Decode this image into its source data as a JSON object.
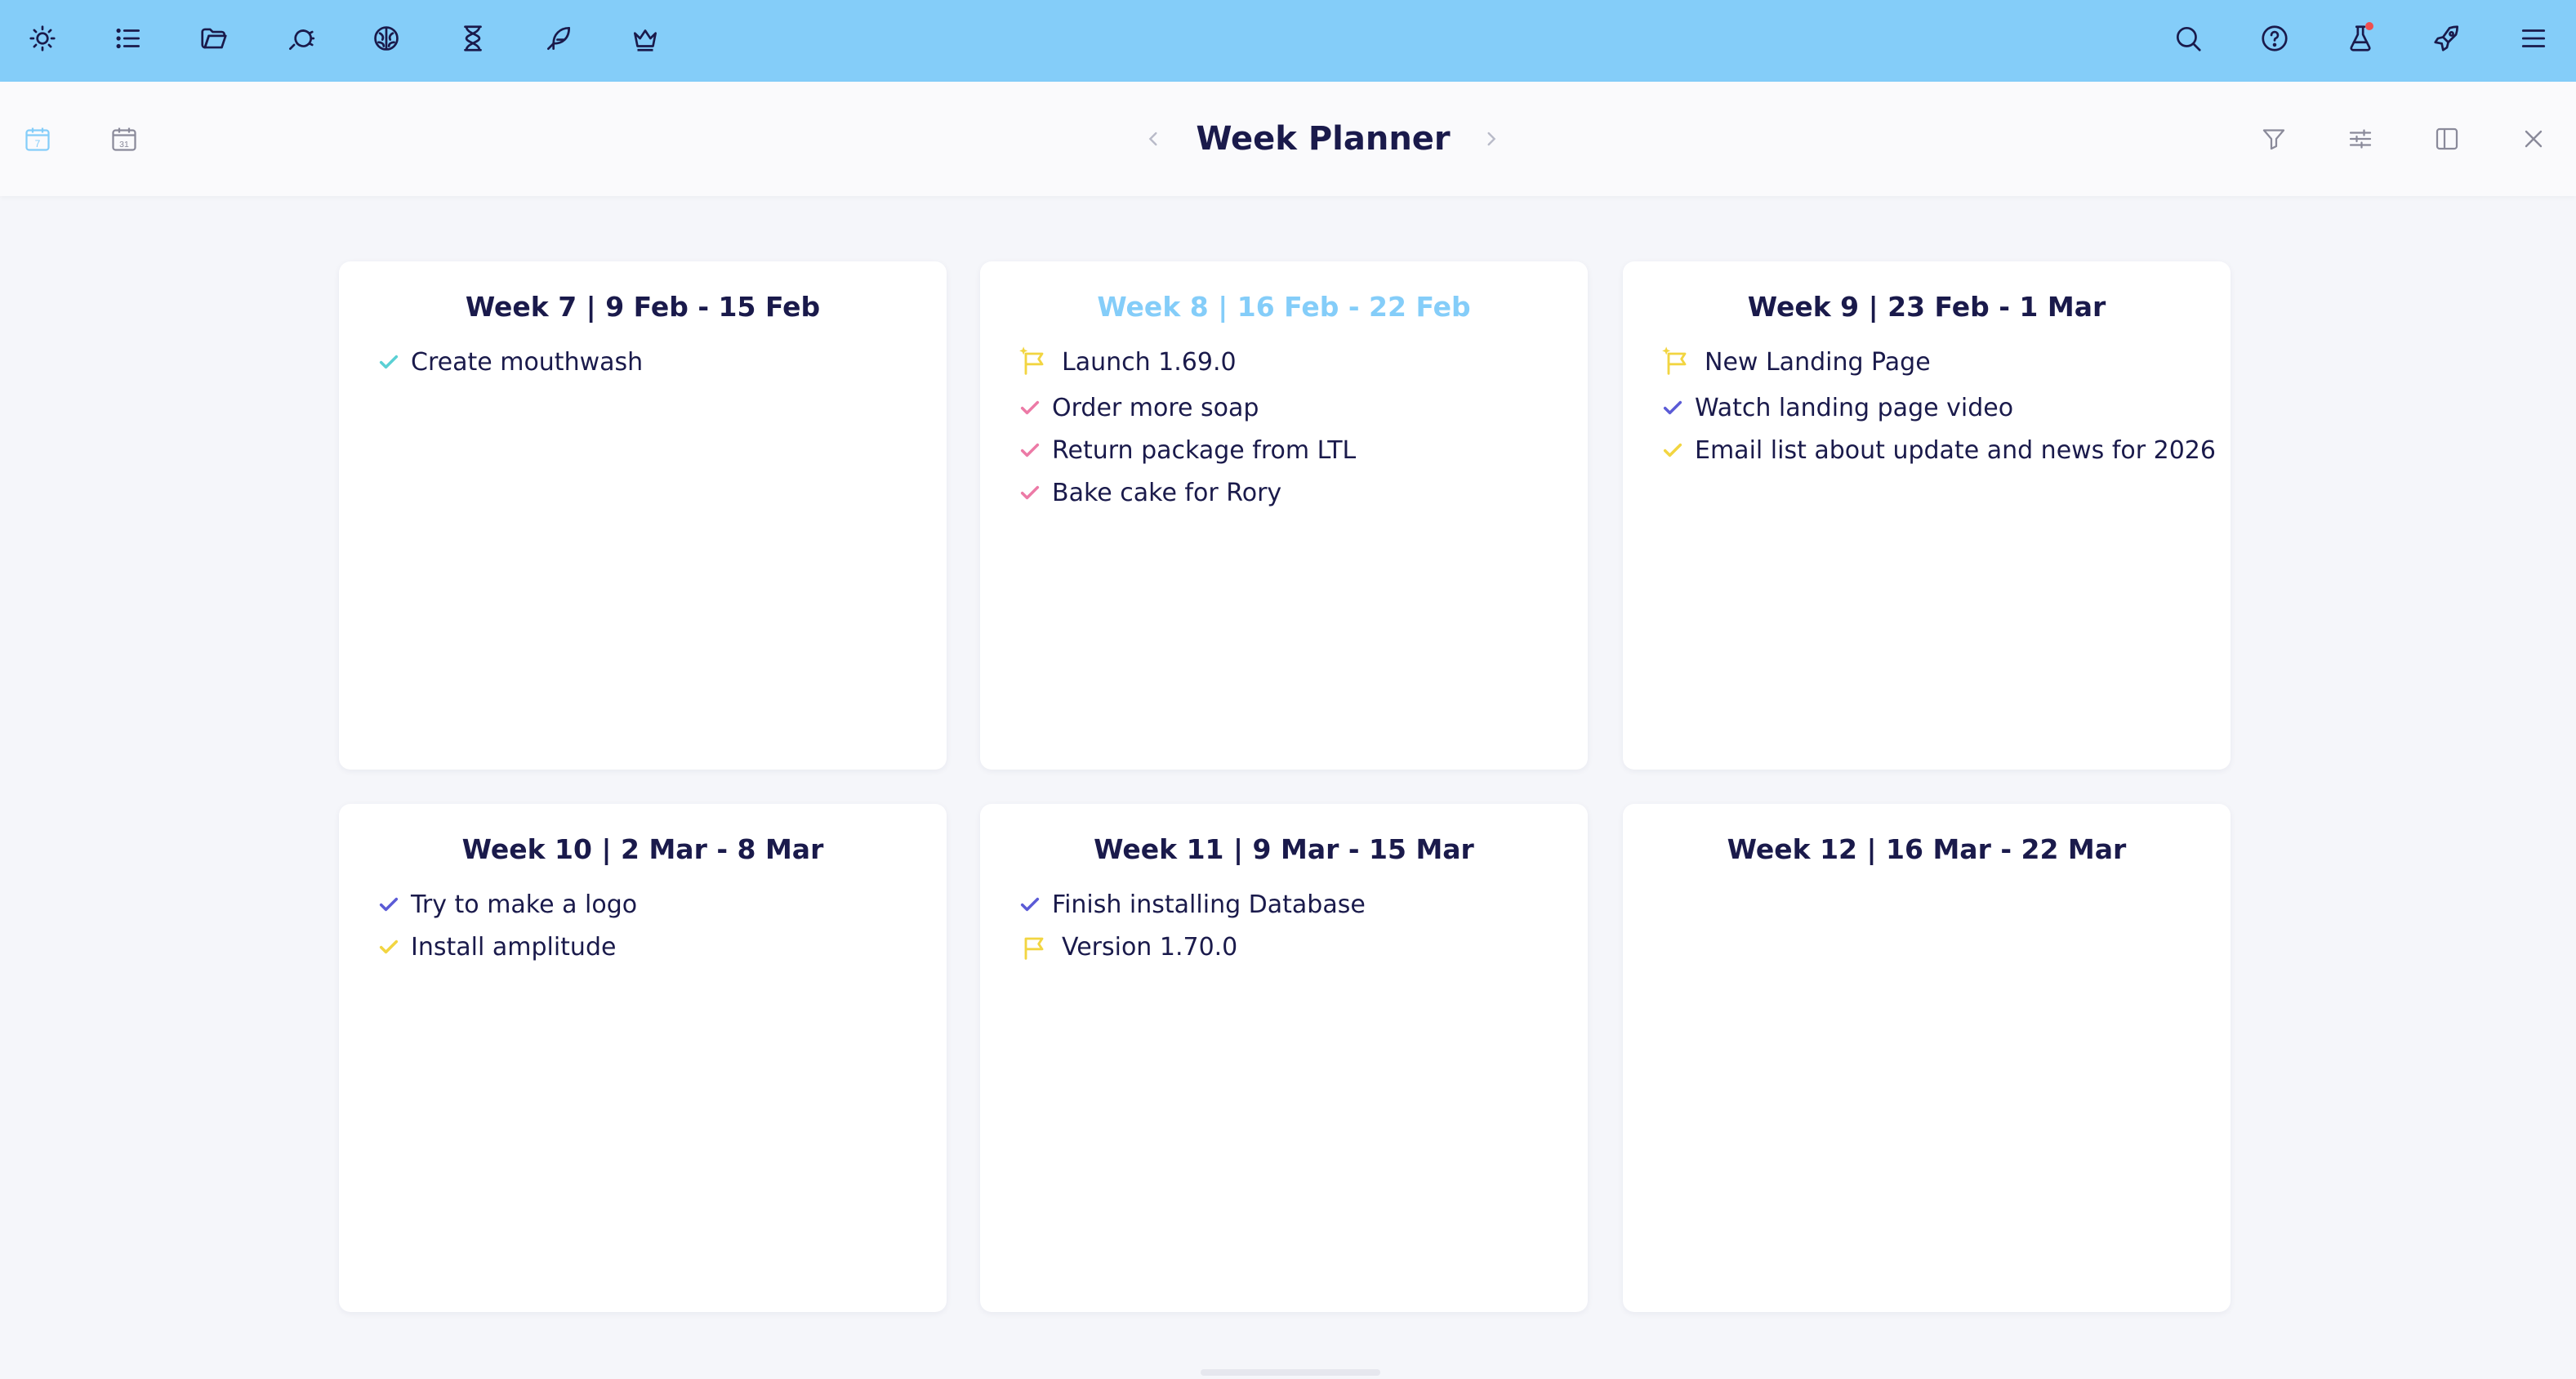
{
  "colors": {
    "topbar": "#84cdf9",
    "accent": "#84cdf9",
    "text": "#1a1a4b",
    "check_teal": "#5ad0d4",
    "check_pink": "#ec7aa6",
    "check_purple": "#5b5bd6",
    "check_yellow": "#f2d541",
    "flag_yellow": "#f2d541",
    "notification": "#ef4f4f"
  },
  "topbar": {
    "left_icons": [
      "sun-icon",
      "list-icon",
      "folder-icon",
      "daydream-icon",
      "brain-icon",
      "hourglass-icon",
      "feather-icon",
      "crown-icon"
    ],
    "right_icons": [
      "search-icon",
      "help-icon",
      "flask-icon",
      "rocket-icon",
      "menu-icon"
    ]
  },
  "header": {
    "title": "Week Planner",
    "week_view_day": "7",
    "month_view_day": "31"
  },
  "weeks": [
    {
      "title": "Week 7 | 9 Feb - 15 Feb",
      "current": false,
      "tasks": [
        {
          "type": "task",
          "label": "Create mouthwash",
          "color": "#5ad0d4"
        }
      ]
    },
    {
      "title": "Week 8 | 16 Feb - 22 Feb",
      "current": true,
      "tasks": [
        {
          "type": "milestone",
          "label": "Launch 1.69.0",
          "color": "#f2d541",
          "sparkle": true
        },
        {
          "type": "task",
          "label": "Order more soap",
          "color": "#ec7aa6"
        },
        {
          "type": "task",
          "label": "Return package from LTL",
          "color": "#ec7aa6"
        },
        {
          "type": "task",
          "label": "Bake cake for Rory",
          "color": "#ec7aa6"
        }
      ]
    },
    {
      "title": "Week 9 | 23 Feb - 1 Mar",
      "current": false,
      "tasks": [
        {
          "type": "milestone",
          "label": "New Landing Page",
          "color": "#f2d541",
          "sparkle": true
        },
        {
          "type": "task",
          "label": "Watch landing page video",
          "color": "#5b5bd6"
        },
        {
          "type": "task",
          "label": "Email list about update and news for 2026",
          "color": "#f2d541"
        }
      ]
    },
    {
      "title": "Week 10 | 2 Mar - 8 Mar",
      "current": false,
      "tasks": [
        {
          "type": "task",
          "label": "Try to make a logo",
          "color": "#5b5bd6"
        },
        {
          "type": "task",
          "label": "Install amplitude",
          "color": "#f2d541"
        }
      ]
    },
    {
      "title": "Week 11 | 9 Mar - 15 Mar",
      "current": false,
      "tasks": [
        {
          "type": "task",
          "label": "Finish installing Database",
          "color": "#5b5bd6"
        },
        {
          "type": "milestone",
          "label": "Version 1.70.0",
          "color": "#f2d541",
          "sparkle": false
        }
      ]
    },
    {
      "title": "Week 12 | 16 Mar - 22 Mar",
      "current": false,
      "tasks": []
    }
  ]
}
